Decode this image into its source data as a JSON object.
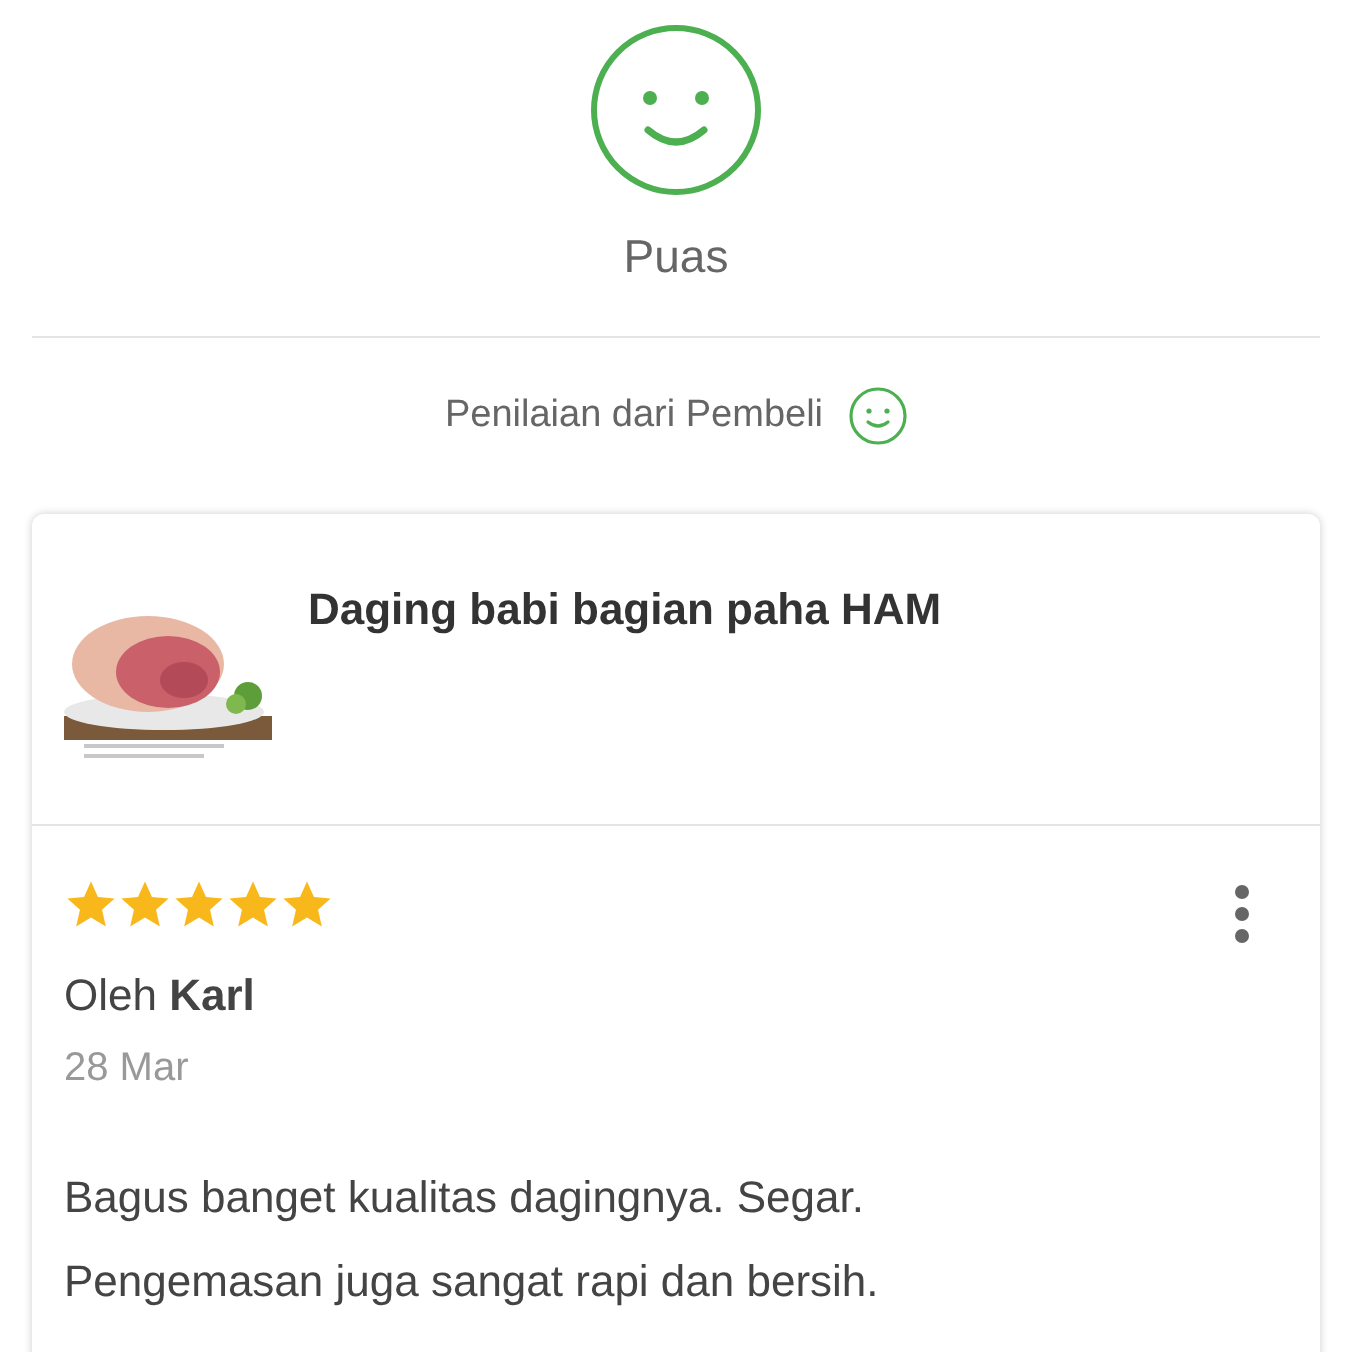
{
  "rating_summary": {
    "label": "Puas"
  },
  "section_title": "Penilaian dari Pembeli",
  "product": {
    "name": "Daging babi bagian paha HAM"
  },
  "review": {
    "stars": 5,
    "author": "Oleh **Karl**",
    "date": "28 Mar",
    "body": [
      "Bagus banget kualitas dagingnya. Segar.",
      "Pengemasan juga sangat rapi dan bersih."
    ]
  }
}
